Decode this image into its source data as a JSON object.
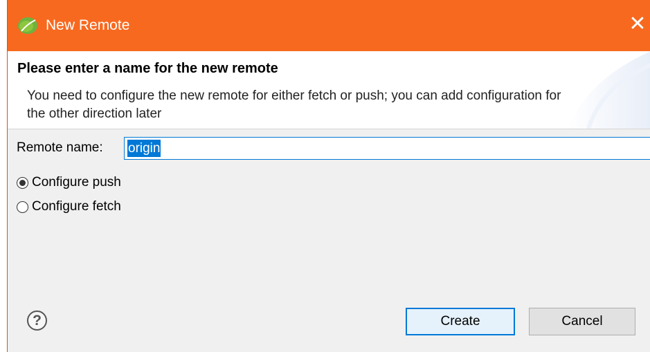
{
  "window": {
    "title": "New Remote",
    "close_glyph": "✕"
  },
  "banner": {
    "title": "Please enter a name for the new remote",
    "description": "You need to configure the new remote for either fetch or push; you can add configuration for the other direction later"
  },
  "form": {
    "remote_name_label": "Remote name:",
    "remote_name_value": "origin",
    "options": [
      {
        "label": "Configure push",
        "selected": true
      },
      {
        "label": "Configure fetch",
        "selected": false
      }
    ]
  },
  "buttons": {
    "help_glyph": "?",
    "create_label": "Create",
    "cancel_label": "Cancel"
  },
  "colors": {
    "titlebar": "#f7691f",
    "selection": "#0078d7",
    "focus_border": "#0078d7"
  },
  "icons": {
    "app": "spring-leaf-icon",
    "close": "close-icon",
    "help": "help-icon"
  }
}
